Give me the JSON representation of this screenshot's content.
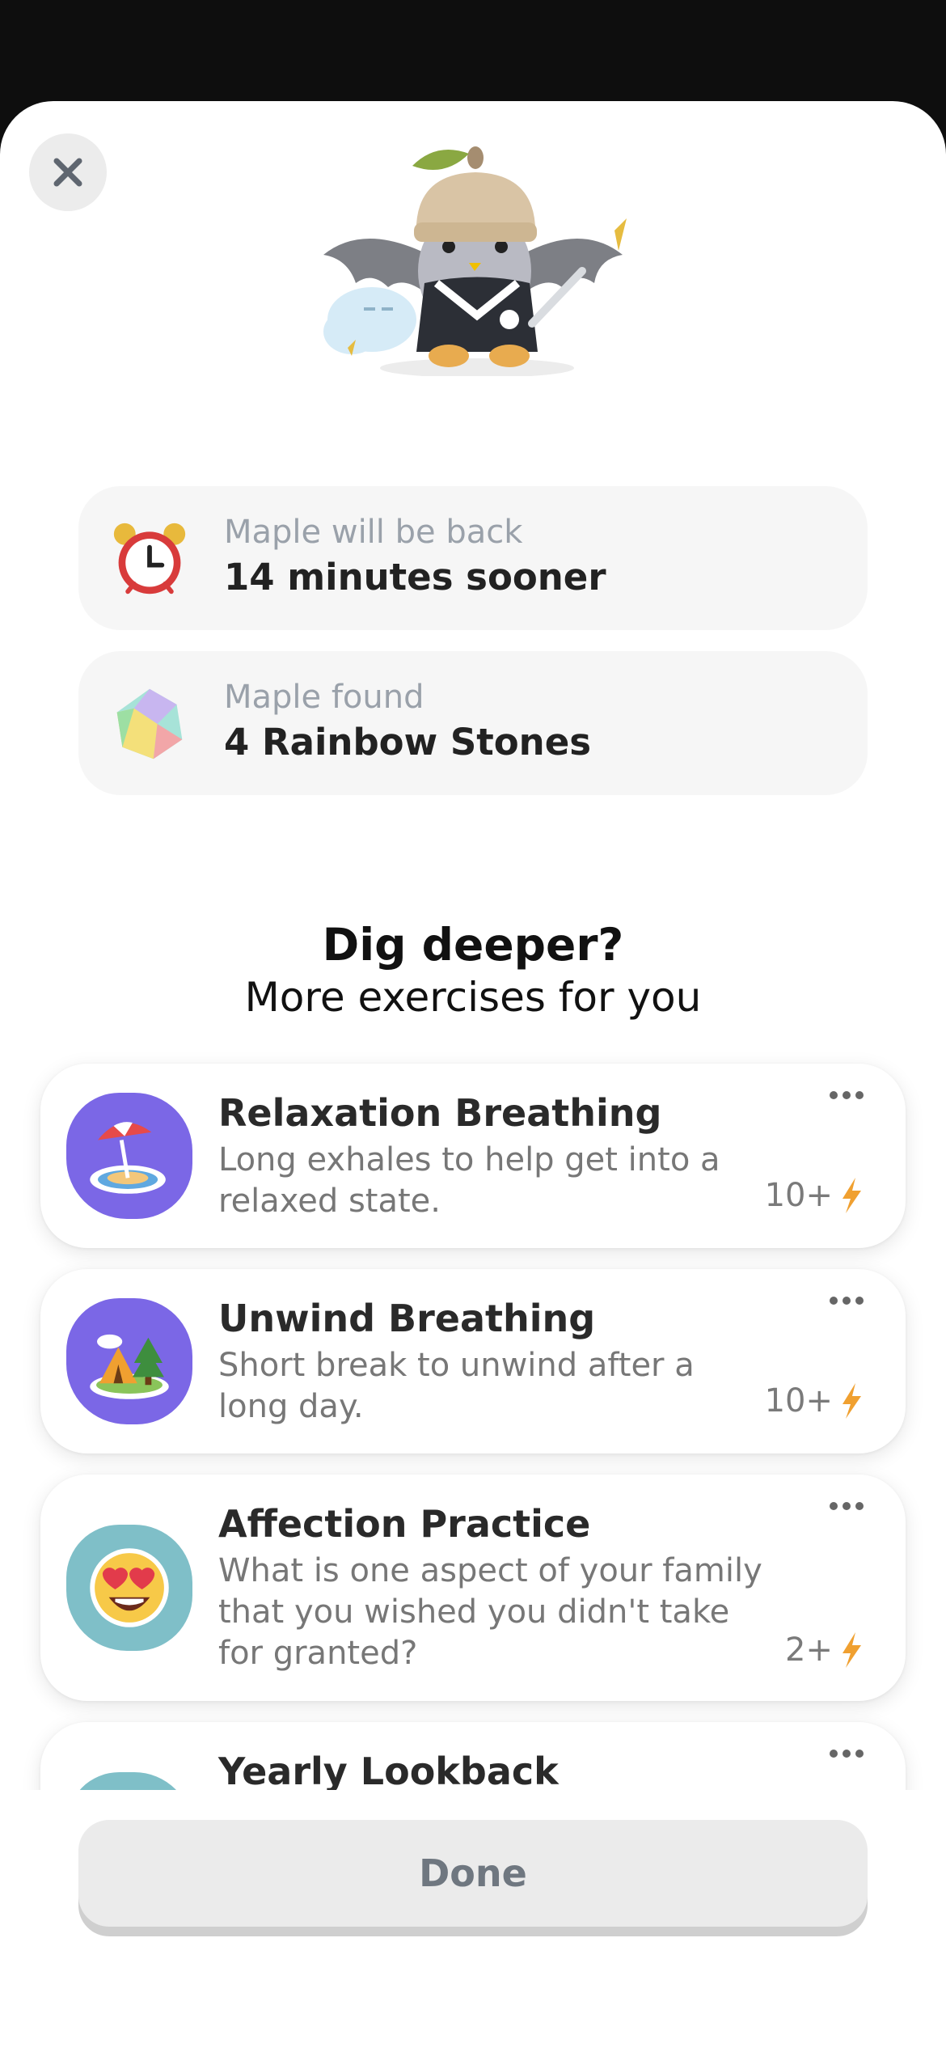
{
  "close": {
    "icon": "close-icon"
  },
  "rewards": [
    {
      "icon": "alarm-clock-icon",
      "sub": "Maple will be back",
      "main": "14 minutes sooner"
    },
    {
      "icon": "rainbow-stone-icon",
      "sub": "Maple found",
      "main": "4 Rainbow Stones"
    }
  ],
  "section": {
    "title": "Dig deeper?",
    "subtitle": "More exercises for you"
  },
  "exercises": [
    {
      "title": "Relaxation Breathing",
      "desc": "Long exhales to help get into a relaxed state.",
      "reward": "10+",
      "icon": "beach-umbrella-icon",
      "color": "#7b67e6"
    },
    {
      "title": "Unwind Breathing",
      "desc": "Short break to unwind after a long day.",
      "reward": "10+",
      "icon": "tent-icon",
      "color": "#7b67e6"
    },
    {
      "title": "Affection Practice",
      "desc": "What is one aspect of your family that you wished you didn't take for granted?",
      "reward": "2+",
      "icon": "heart-eyes-icon",
      "color": "#7fbfc8"
    },
    {
      "title": "Yearly Lookback",
      "desc": "",
      "reward": "",
      "icon": "unknown-icon",
      "color": "#7fbfc8"
    }
  ],
  "footer": {
    "done_label": "Done"
  }
}
